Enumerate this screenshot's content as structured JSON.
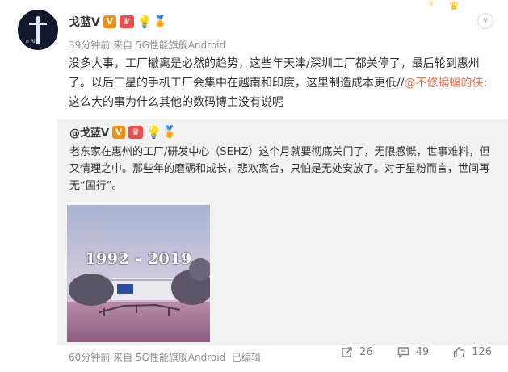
{
  "post": {
    "user": {
      "name": "戈蓝V"
    },
    "meta": "39分钟前 来自 5G性能旗舰Android",
    "content_before": "没多大事，工厂撤离是必然的趋势，这些年天津/深圳工厂都关停了，最后轮到惠州了。以后三星的手机工厂会集中在越南和印度，这里制造成本更低//",
    "mention": "@不修蝙蝠的侠",
    "content_after": ":这么大的事为什么其他的数码博主没有说呢"
  },
  "repost": {
    "user": "@戈蓝V",
    "text": "老东家在惠州的工厂/研发中心（SEHZ）这个月就要彻底关门了，无限感慨，世事难料，但又情理之中。那些年的磨砺和成长，悲欢离合，只怕是无处安放了。对于星粉而言，世间再无“国行”。",
    "image_caption": "1992 - 2019",
    "meta": "60分钟前 来自 5G性能旗舰Android",
    "edited": "已编辑",
    "stats": {
      "reposts": "26",
      "comments": "49",
      "likes": "126"
    }
  },
  "icons": {
    "badges": [
      "verified-v-icon",
      "vip-icon",
      "bulb-icon",
      "medal-icon"
    ],
    "actions": [
      "repost-icon",
      "comment-icon",
      "like-icon"
    ],
    "chevron": "chevron-down-icon"
  },
  "colors": {
    "mention": "#eb7350",
    "meta": "#939393",
    "repost_bg": "#f2f2f2",
    "verified": "#f28f11"
  }
}
